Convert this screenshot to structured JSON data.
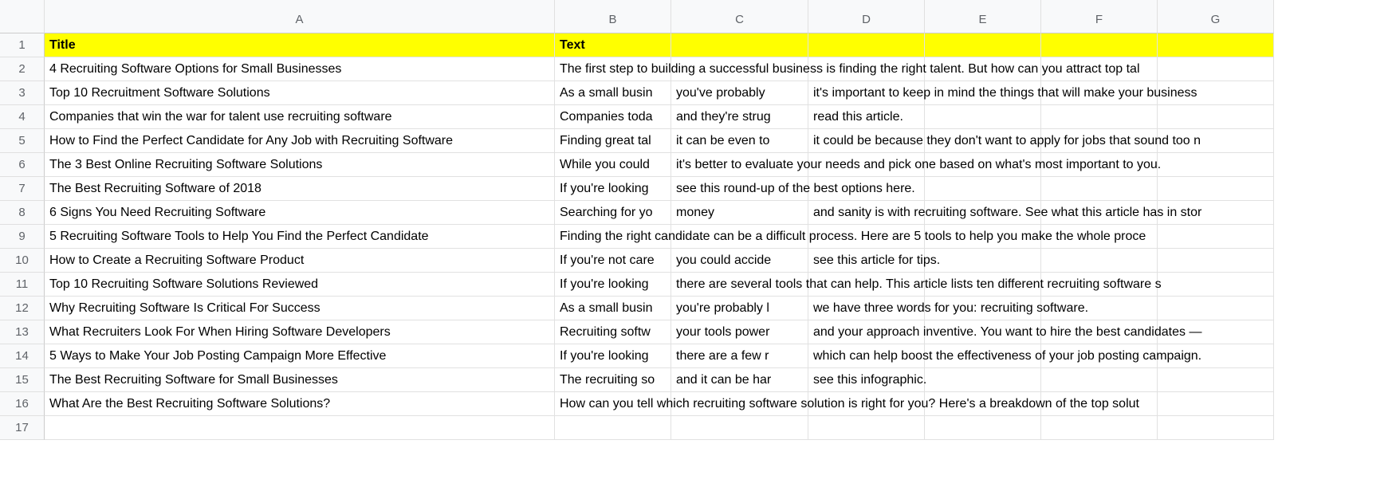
{
  "columns": [
    "A",
    "B",
    "C",
    "D",
    "E",
    "F",
    "G"
  ],
  "header_row": {
    "A": "Title",
    "B": "Text"
  },
  "rows": [
    {
      "A": "4 Recruiting Software Options for Small Businesses",
      "B": "The first step to building a successful business is finding the right talent. But how can you attract top tal"
    },
    {
      "A": "Top 10 Recruitment Software Solutions",
      "B": "As a small busin",
      "C": "you've probably ",
      "D": "it's important to keep in mind the things that will make your business"
    },
    {
      "A": "Companies that win the war for talent use recruiting software",
      "B": "Companies toda",
      "C": "and they're strug",
      "D": "read this article."
    },
    {
      "A": "How to Find the Perfect Candidate for Any Job with Recruiting Software",
      "B": "Finding great tal",
      "C": "it can be even to",
      "D": "it could be because they don't want to apply for jobs that sound too n"
    },
    {
      "A": "The 3 Best Online Recruiting Software Solutions",
      "B": "While you could",
      "C": "it's better to evaluate your needs and pick one based on what's most important to you."
    },
    {
      "A": "The Best Recruiting Software of 2018",
      "B": "If you're looking ",
      "C": "see this round-up of the best options here."
    },
    {
      "A": "6 Signs You Need Recruiting Software",
      "B": "Searching for yo",
      "C": "money",
      "D": "and sanity is with recruiting software. See what this article has in stor"
    },
    {
      "A": "5 Recruiting Software Tools to Help You Find the Perfect Candidate",
      "B": "Finding the right candidate can be a difficult process. Here are 5 tools to help you make the whole proce"
    },
    {
      "A": "How to Create a Recruiting Software Product",
      "B": "If you're not care",
      "C": "you could accide",
      "D": "see this article for tips."
    },
    {
      "A": "Top 10 Recruiting Software Solutions Reviewed",
      "B": "If you're looking ",
      "C": "there are several tools that can help. This article lists ten different recruiting software s"
    },
    {
      "A": "Why Recruiting Software Is Critical For Success",
      "B": "As a small busin",
      "C": "you're probably l",
      "D": "we have three words for you: recruiting software."
    },
    {
      "A": "What Recruiters Look For When Hiring Software Developers",
      "B": "Recruiting softw",
      "C": "your tools power",
      "D": "and your approach inventive. You want to hire the best candidates —"
    },
    {
      "A": "5 Ways to Make Your Job Posting Campaign More Effective",
      "B": "If you're looking ",
      "C": "there are a few r",
      "D": "which can help boost the effectiveness of your job posting campaign."
    },
    {
      "A": "The Best Recruiting Software for Small Businesses",
      "B": "The recruiting so",
      "C": "and it can be har",
      "D": "see this infographic."
    },
    {
      "A": "What Are the Best Recruiting Software Solutions?",
      "B": "How can you tell which recruiting software solution is right for you? Here's a breakdown of the top solut"
    }
  ],
  "empty_rows_after": 1
}
